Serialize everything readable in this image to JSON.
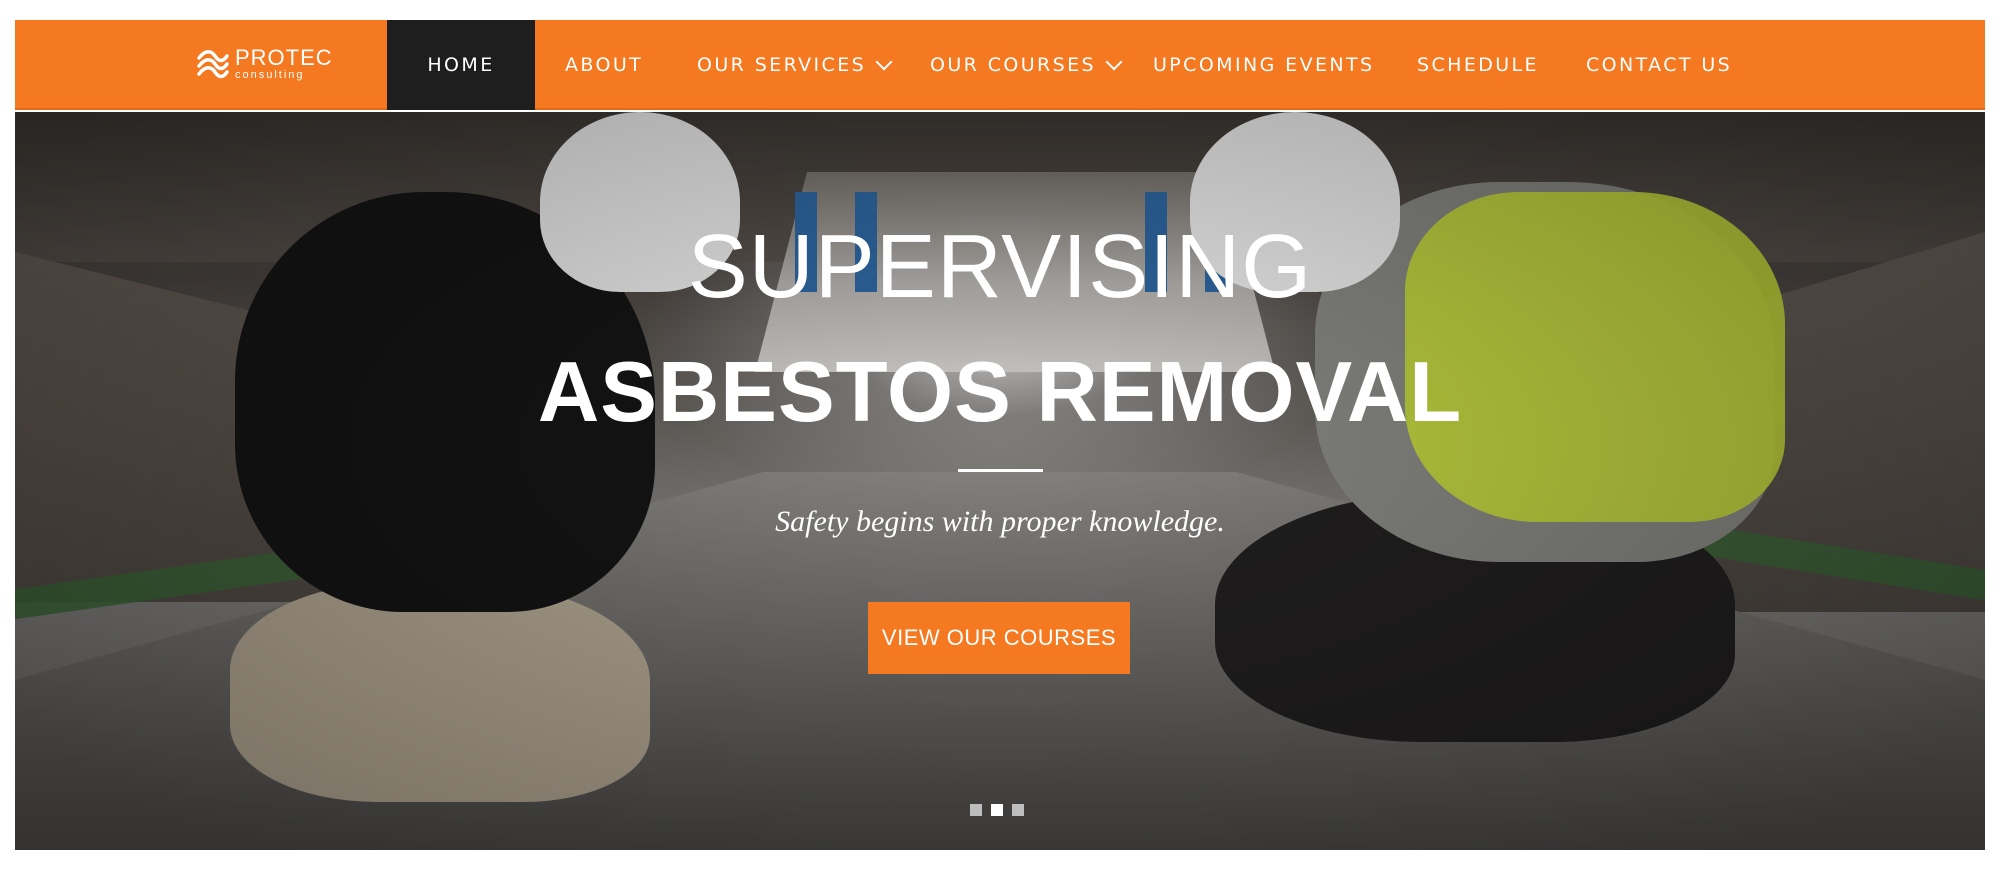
{
  "brand": {
    "name": "PROTEC",
    "tagline": "consulting",
    "accent_color": "#f47920"
  },
  "nav": {
    "items": [
      {
        "label": "HOME",
        "active": true
      },
      {
        "label": "ABOUT"
      },
      {
        "label": "OUR SERVICES",
        "icon": "chevron-down-icon"
      },
      {
        "label": "OUR COURSES",
        "icon": "chevron-down-icon"
      },
      {
        "label": "UPCOMING EVENTS"
      },
      {
        "label": "SCHEDULE"
      },
      {
        "label": "CONTACT US"
      }
    ]
  },
  "hero": {
    "title_line1": "SUPERVISING",
    "title_line2": "ASBESTOS REMOVAL",
    "tagline": "Safety begins with proper knowledge.",
    "cta_label": "VIEW OUR COURSES",
    "slides_total": 3,
    "active_slide": 2
  }
}
